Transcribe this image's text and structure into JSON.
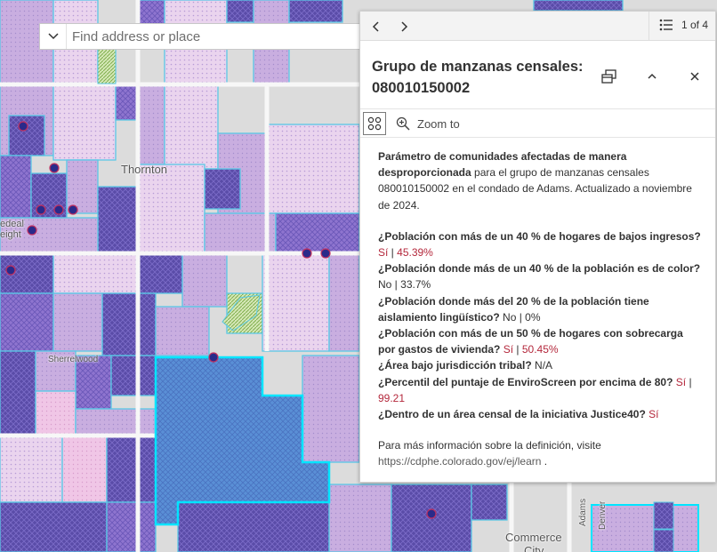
{
  "map": {
    "labels": {
      "thornton": "Thornton",
      "federal_heights_1": "edeal",
      "federal_heights_2": "eight",
      "sherrelwood": "Sherrelwood",
      "commerce_city_1": "Commerce",
      "commerce_city_2": "City",
      "adams": "Adams",
      "denver": "Denver"
    },
    "colors": {
      "base": "#dcdcdc",
      "light_pink": "#ead4ee",
      "lavender": "#c9aee0",
      "purple": "#8e74cf",
      "dark_purple": "#5a4ca8",
      "selected_fill": "#5a8fd6",
      "highlight_border": "#00e5ff",
      "tract_line": "#5ac8e6",
      "road": "#f5f5f5",
      "green_hatch": "#9cc96b"
    }
  },
  "search": {
    "placeholder": "Find address or place",
    "icon": "chevron-down-icon"
  },
  "popup": {
    "pager": "1 of 4",
    "title_line1": "Grupo de manzanas censales:",
    "title_line2": "080010150002",
    "zoom_to": "Zoom to",
    "intro_bold": "Parámetro de comunidades afectadas de manera desproporcionada",
    "intro_rest": " para el grupo de manzanas censales 080010150002 en el condado de Adams. Actualizado a noviembre de 2024.",
    "questions": [
      {
        "q": "¿Población con más de un 40 % de hogares de bajos ingresos?",
        "a": "Sí",
        "sep": "|",
        "v": "45.39%",
        "red": true
      },
      {
        "q": "¿Población donde más de un 40 % de la población es de color?",
        "a": "No",
        "sep": "|",
        "v": "33.7%",
        "red": false
      },
      {
        "q": "¿Población donde más del 20 % de la población tiene aislamiento lingüístico?",
        "a": "No",
        "sep": "|",
        "v": "0%",
        "red": false
      },
      {
        "q": "¿Población con más de un 50 % de hogares con sobrecarga por gastos de vivienda?",
        "a": "Sí",
        "sep": "|",
        "v": "50.45%",
        "red": true
      },
      {
        "q": "¿Área bajo jurisdicción tribal?",
        "a": "N/A",
        "sep": "",
        "v": "",
        "red": false
      },
      {
        "q": "¿Percentil del puntaje de EnviroScreen por encima de 80?",
        "a": "Sí",
        "sep": "|",
        "v": "99.21",
        "red": true
      },
      {
        "q": "¿Dentro de un área censal de la iniciativa Justice40?",
        "a": "Sí",
        "sep": "",
        "v": "",
        "red": true
      }
    ],
    "more_info": "Para más información sobre la definición, visite",
    "more_link": "https://cdphe.colorado.gov/ej/learn",
    "more_tail": " ."
  }
}
